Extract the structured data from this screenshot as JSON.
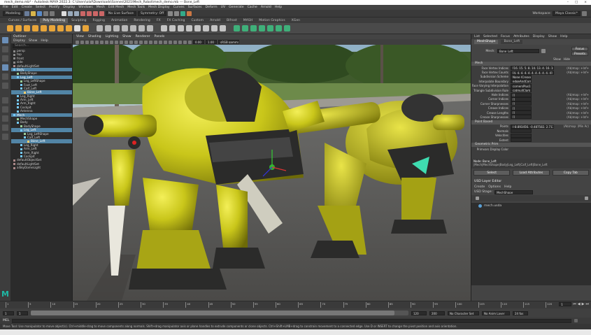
{
  "window": {
    "title": "mech_demo.mb* - Autodesk MAYA 2022.3: C:\\Users\\olaf\\Downloads\\Scenes\\2021\\Mech_Robot\\mech_demo.mb --- Bone_Left",
    "controls": [
      "–",
      "□",
      "×"
    ]
  },
  "menubar": [
    "File",
    "Edit",
    "Create",
    "Select",
    "Modify",
    "Display",
    "Windows",
    "Mesh",
    "Edit Mesh",
    "Mesh Tools",
    "Mesh Display",
    "Curves",
    "Surfaces",
    "Deform",
    "UV",
    "Generate",
    "Cache",
    "Arnold",
    "Help"
  ],
  "statusline": {
    "mode": "Modeling",
    "no_live": "No Live Surface",
    "symmetry": "Symmetry: Off",
    "workspace_label": "Workspace:",
    "workspace": "Maya Classic*"
  },
  "shelf_tabs": [
    "Curves / Surfaces",
    "Poly Modeling",
    "Sculpting",
    "Rigging",
    "Animation",
    "Rendering",
    "FX",
    "FX Caching",
    "Custom",
    "Arnold",
    "Bifrost",
    "MASH",
    "Motion Graphics",
    "XGen"
  ],
  "shelf_active": 1,
  "outliner": {
    "title": "Outliner",
    "menu": [
      "Display",
      "Show",
      "Help"
    ],
    "search_placeholder": "Search...",
    "items": [
      {
        "label": "persp",
        "depth": 0,
        "sel": false,
        "color": "#8a8a8a"
      },
      {
        "label": "top",
        "depth": 0,
        "sel": false,
        "color": "#8a8a8a"
      },
      {
        "label": "front",
        "depth": 0,
        "sel": false,
        "color": "#8a8a8a"
      },
      {
        "label": "side",
        "depth": 0,
        "sel": false,
        "color": "#8a8a8a"
      },
      {
        "label": "defaultLightSet",
        "depth": 0,
        "sel": false,
        "color": "#a88"
      },
      {
        "label": "Body",
        "depth": 0,
        "sel": true,
        "color": "#7cf"
      },
      {
        "label": "BodyShape",
        "depth": 1,
        "sel": false,
        "color": "#9c9"
      },
      {
        "label": "Leg_Left",
        "depth": 1,
        "sel": true,
        "color": "#7cf"
      },
      {
        "label": "Leg_LeftShape",
        "depth": 2,
        "sel": false,
        "color": "#9c9"
      },
      {
        "label": "Foot_Left",
        "depth": 2,
        "sel": false,
        "color": "#7cf"
      },
      {
        "label": "Calf_Left",
        "depth": 2,
        "sel": false,
        "color": "#7cf"
      },
      {
        "label": "Bone_Left",
        "depth": 3,
        "sel": true,
        "color": "#fc6"
      },
      {
        "label": "Leg_Right",
        "depth": 1,
        "sel": false,
        "color": "#7cf"
      },
      {
        "label": "Arm_Left",
        "depth": 1,
        "sel": false,
        "color": "#7cf"
      },
      {
        "label": "Arm_Right",
        "depth": 1,
        "sel": false,
        "color": "#7cf"
      },
      {
        "label": "Cockpit",
        "depth": 1,
        "sel": false,
        "color": "#7cf"
      },
      {
        "label": "Antenna",
        "depth": 1,
        "sel": false,
        "color": "#7cf"
      },
      {
        "label": "Mech",
        "depth": 0,
        "sel": true,
        "color": "#7cf"
      },
      {
        "label": "MechShape",
        "depth": 1,
        "sel": false,
        "color": "#9c9"
      },
      {
        "label": "Body",
        "depth": 1,
        "sel": false,
        "color": "#7cf"
      },
      {
        "label": "BodyShape",
        "depth": 2,
        "sel": false,
        "color": "#9c9"
      },
      {
        "label": "Leg_Left",
        "depth": 2,
        "sel": true,
        "color": "#7cf"
      },
      {
        "label": "Leg_LeftShape",
        "depth": 3,
        "sel": false,
        "color": "#9c9"
      },
      {
        "label": "Calf_Left",
        "depth": 3,
        "sel": false,
        "color": "#7cf"
      },
      {
        "label": "Bone_Left",
        "depth": 4,
        "sel": true,
        "color": "#fc6"
      },
      {
        "label": "Leg_Right",
        "depth": 2,
        "sel": false,
        "color": "#7cf"
      },
      {
        "label": "Arm_Left",
        "depth": 2,
        "sel": false,
        "color": "#7cf"
      },
      {
        "label": "Arm_Right",
        "depth": 2,
        "sel": false,
        "color": "#7cf"
      },
      {
        "label": "Cockpit",
        "depth": 2,
        "sel": false,
        "color": "#7cf"
      },
      {
        "label": "defaultObjectSet",
        "depth": 0,
        "sel": false,
        "color": "#a88"
      },
      {
        "label": "defaultLightSet",
        "depth": 0,
        "sel": false,
        "color": "#a88"
      },
      {
        "label": "aiSkyDomeLight",
        "depth": 0,
        "sel": false,
        "color": "#a88"
      }
    ]
  },
  "viewport": {
    "menu": [
      "View",
      "Shading",
      "Lighting",
      "Show",
      "Renderer",
      "Panels"
    ],
    "gamma": "sRGB gamma",
    "exposure": "0.00",
    "gamma_value": "1.00"
  },
  "attr_editor": {
    "tabs": [
      "List",
      "Selected",
      "Focus",
      "Attributes",
      "Display",
      "Show",
      "Help"
    ],
    "node_tabs": [
      "MeshShape",
      "Bone_Left"
    ],
    "mesh_label": "Mesh:",
    "mesh_value": "Bone_Left",
    "focus_btn": "Focus",
    "presets_btn": "Presets",
    "show_btn": "Show",
    "hide_btn": "Hide",
    "section_mesh": "Mesh",
    "attrs": [
      {
        "label": "Face Vertex Indices",
        "value": "[16, 15, 5, 8, 14, 13, 4, 16, 16, 24]",
        "tag": "(Ab)map: +Inf+"
      },
      {
        "label": "Face Vertex Counts",
        "value": "[4, 4, 4, 4, 4, 4, 4, 4, 4, 4, 4]",
        "tag": "(Ab)map: +Inf+"
      },
      {
        "label": "Subdivision Scheme",
        "value": "None (Crease)",
        "tag": ""
      },
      {
        "label": "Interpolate Boundary",
        "value": "edgeAndCorner",
        "tag": ""
      },
      {
        "label": "Face Varying Interpolation",
        "value": "cornersPlus1",
        "tag": ""
      },
      {
        "label": "Triangle Subdivision Rule",
        "value": "catmullClark",
        "tag": ""
      },
      {
        "label": "Hole Indices",
        "value": "[]",
        "tag": "(Ab)map: +Inf+"
      },
      {
        "label": "Corner Indices",
        "value": "[]",
        "tag": "(Ab)map: +Inf+"
      },
      {
        "label": "Corner Sharpnesses",
        "value": "[]",
        "tag": "(Ab)map: +Inf+"
      },
      {
        "label": "Crease Indices",
        "value": "[]",
        "tag": "(Ab)map: +Inf+"
      },
      {
        "label": "Crease Lengths",
        "value": "[]",
        "tag": "(Ab)map: +Inf+"
      },
      {
        "label": "Crease Sharpnesses",
        "value": "[]",
        "tag": "(Ab)map: +Inf+"
      }
    ],
    "section_point": "Point Based",
    "point_attrs": [
      {
        "label": "Points",
        "value": "(-8.893456, -0.487582, 2.717541), (8.93...",
        "tag": "(Ab)map: (Min Ac)"
      },
      {
        "label": "Normals",
        "value": "",
        "tag": ""
      },
      {
        "label": "Velocities",
        "value": "",
        "tag": ""
      },
      {
        "label": "Extent",
        "value": "",
        "tag": ""
      }
    ],
    "section_geom": "Geometric Prim",
    "geom_attr_label": "Primvars Display Color",
    "node_path_label": "Node: Bone_Left",
    "node_path": "|Mech|MechShape|Body|Leg_Left|Calf_Left|Bone_Left",
    "bottom_buttons": [
      "Select",
      "Load Attributes",
      "Copy Tab"
    ]
  },
  "usd_layer_editor": {
    "title": "USD Layer Editor",
    "menu": [
      "Create",
      "Options",
      "Help"
    ],
    "stage_label": "USD Stage:",
    "stage_value": "MechShape",
    "layer": "mech.usda"
  },
  "timeline": {
    "ticks": [
      "1",
      "5",
      "10",
      "15",
      "20",
      "25",
      "30",
      "35",
      "40",
      "45",
      "50",
      "55",
      "60",
      "65",
      "70",
      "75",
      "80",
      "85",
      "90",
      "95",
      "100",
      "105",
      "110",
      "115",
      "120"
    ],
    "current_frame": "1"
  },
  "rangebar": {
    "start": "1",
    "range_start": "1",
    "range_end": "120",
    "end": "200",
    "char_set": "No Character Set",
    "anim_layer": "No Anim Layer",
    "fps": "24 fps"
  },
  "cmdline": {
    "lang": "MEL"
  },
  "helpline": {
    "text": "Move Tool: Use manipulator to move object(s). Ctrl+middle-drag to move components along normals. Shift+drag manipulator axis or plane handles to extrude components or clone objects. Ctrl+Shift+LMB+drag to constrain movement to a connected edge. Use D or INSERT to change the pivot position and axis orientation."
  },
  "colors": {
    "mech_yellow": "#c9c61a",
    "mech_dark": "#2b2b2a",
    "sel_blue": "#5285a6",
    "maya_logo": "#1fb8a5"
  },
  "logo_text": "M"
}
